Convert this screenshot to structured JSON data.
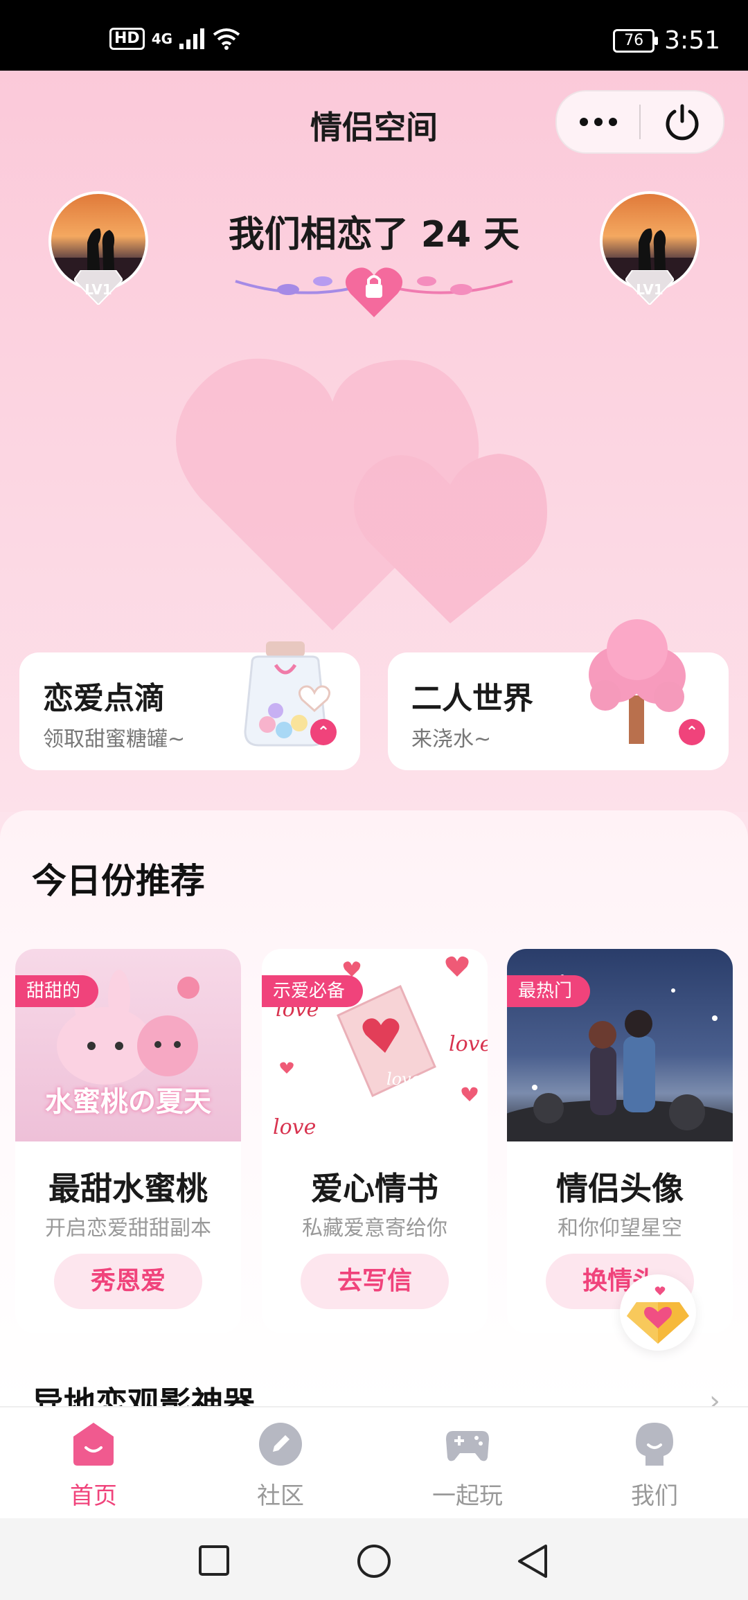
{
  "status_bar": {
    "hd": "HD",
    "network": "4G",
    "battery": "76",
    "time": "3:51"
  },
  "header": {
    "title": "情侣空间",
    "menu_icon": "more-dots-icon",
    "power_icon": "power-icon"
  },
  "couple": {
    "left_level": "LV1",
    "right_level": "LV1",
    "love_text": "我们相恋了 24 天"
  },
  "cards": [
    {
      "title": "恋爱点滴",
      "subtitle": "领取甜蜜糖罐~"
    },
    {
      "title": "二人世界",
      "subtitle": "来浇水~"
    }
  ],
  "recommend": {
    "title": "今日份推荐",
    "items": [
      {
        "tag": "甜甜的",
        "image_text": "水蜜桃の夏天",
        "name": "最甜水蜜桃",
        "desc": "开启恋爱甜甜副本",
        "button": "秀恩爱"
      },
      {
        "tag": "示爱必备",
        "image_text": "love",
        "name": "爱心情书",
        "desc": "私藏爱意寄给你",
        "button": "去写信"
      },
      {
        "tag": "最热门",
        "image_text": "",
        "name": "情侣头像",
        "desc": "和你仰望星空",
        "button": "换情头"
      }
    ]
  },
  "next_section": {
    "title": "异地恋观影神器"
  },
  "tabs": [
    {
      "label": "首页",
      "icon": "home-icon",
      "active": true
    },
    {
      "label": "社区",
      "icon": "community-icon",
      "active": false
    },
    {
      "label": "一起玩",
      "icon": "gamepad-icon",
      "active": false
    },
    {
      "label": "我们",
      "icon": "profile-icon",
      "active": false
    }
  ],
  "colors": {
    "accent": "#f0437b",
    "background": "#fde3ec"
  }
}
